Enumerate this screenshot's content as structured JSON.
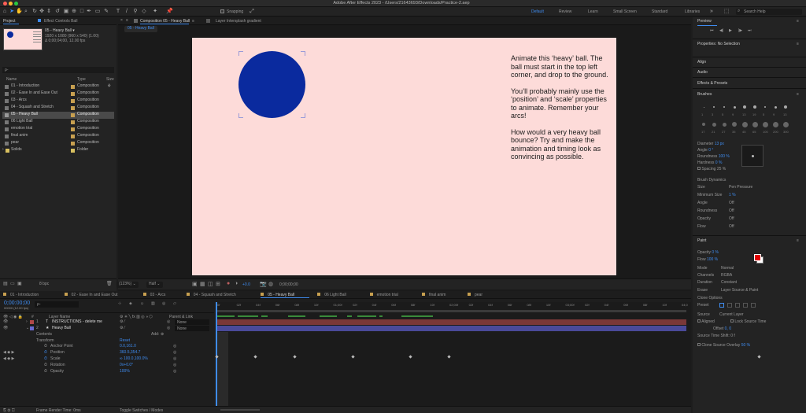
{
  "window_title": "Adobe After Effects 2023 - /Users/21643693/Downloads/Practice-2.aep",
  "toolbar": {
    "snapping": "Snapping",
    "search_placeholder": "Search Help",
    "workspaces": [
      "Default",
      "Review",
      "Learn",
      "Small Screen",
      "Standard",
      "Libraries"
    ]
  },
  "project": {
    "tab": "Project",
    "effect_tab": "Effect Controls Ball",
    "item_name": "05 - Heavy Ball ▾",
    "item_info1": "1920 x 1080 (960 x 540) (1.00)",
    "item_info2": "Δ 0;00;04;00, 12.00 fps",
    "search_placeholder": "ρ-",
    "columns": {
      "name": "Name",
      "type": "Type",
      "size": "Size"
    },
    "items": [
      {
        "name": "01 - Introduction",
        "type": "Composition",
        "color": "#c8a050"
      },
      {
        "name": "02 - Ease In and Ease Out",
        "type": "Composition",
        "color": "#c8a050"
      },
      {
        "name": "03 - Arcs",
        "type": "Composition",
        "color": "#c8a050"
      },
      {
        "name": "04 - Squash and Stretch",
        "type": "Composition",
        "color": "#c8a050"
      },
      {
        "name": "05 - Heavy Ball",
        "type": "Composition",
        "color": "#c8a050"
      },
      {
        "name": "06 Light Ball",
        "type": "Composition",
        "color": "#c8a050"
      },
      {
        "name": "emotion trial",
        "type": "Composition",
        "color": "#c8a050"
      },
      {
        "name": "final anim",
        "type": "Composition",
        "color": "#c8a050"
      },
      {
        "name": "pear",
        "type": "Composition",
        "color": "#c8a050"
      },
      {
        "name": "Solids",
        "type": "Folder",
        "color": "#d8c060"
      }
    ],
    "bpc": "8 bpc"
  },
  "composition": {
    "tab_label": "Composition 05 - Heavy Ball",
    "tab_menu": "≡",
    "layer_tab": "Layer Intersplash gradient",
    "breadcrumb": "05 - Heavy Ball",
    "instructions": [
      "Animate this ‘heavy’ ball. The ball must start in the top left corner, and drop to the ground.",
      "You’ll probably mainly use the ‘position’ and ‘scale’ properties to animate. Remember your arcs!",
      "How would a very heavy ball bounce? Try and make the animation and timing look as convincing as possible."
    ],
    "colors": {
      "canvas": "#fddbd9",
      "ball": "#0a2a9e"
    },
    "footer": {
      "zoom": "(123%)",
      "resolution": "Half",
      "exposure": "+0.0",
      "timecode": "0;00;00;00"
    }
  },
  "timeline": {
    "tabs": [
      "01 - Introduction",
      "02 - Ease In and Ease Out",
      "03 - Arcs",
      "04 - Squash and Stretch",
      "05 - Heavy Ball",
      "06 Light Ball",
      "emotion trial",
      "final anim",
      "pear"
    ],
    "active_tab": "05 - Heavy Ball",
    "timecode": "0;00:00;00",
    "fps": "00000 (12.00 fps)",
    "search_placeholder": "ρ-",
    "columns": {
      "layer_name": "Layer Name",
      "parent": "Parent & Link"
    },
    "layers": [
      {
        "num": "1",
        "name": "INSTRUCTIONS - delete me",
        "parent": "None",
        "color": "#b04848"
      },
      {
        "num": "2",
        "name": "Heavy Ball",
        "parent": "None",
        "color": "#6a6ad0"
      }
    ],
    "contents": "Contents",
    "add": "Add:",
    "transform": "Transform",
    "reset": "Reset",
    "properties": [
      {
        "name": "Anchor Point",
        "value": "0.0,161.0"
      },
      {
        "name": "Position",
        "value": "360.5,354.7"
      },
      {
        "name": "Scale",
        "value": "∞ 100.0,100.0%"
      },
      {
        "name": "Rotation",
        "value": "0x+0.0°"
      },
      {
        "name": "Opacity",
        "value": "100%"
      }
    ],
    "ruler_ticks": [
      "0f",
      "02f",
      "04f",
      "06f",
      "08f",
      "10f",
      "01;00f",
      "02f",
      "04f",
      "06f",
      "08f",
      "10f",
      "02;00f",
      "02f",
      "04f",
      "06f",
      "08f",
      "10f",
      "03;00f",
      "02f",
      "04f",
      "06f",
      "08f",
      "10f",
      "04;0"
    ],
    "position_keyframes_s": [
      0.0,
      0.33,
      0.67,
      1.17,
      1.67,
      2.0,
      4.67
    ],
    "footer": {
      "render_time": "Frame Render Time: 0ms",
      "toggle": "Toggle Switches / Modes"
    }
  },
  "right": {
    "preview": "Preview",
    "properties": "Properties: No Selection",
    "align": "Align",
    "audio": "Audio",
    "effects": "Effects & Presets",
    "brushes": "Brushes",
    "brush_sizes": [
      "1",
      "3",
      "5",
      "9",
      "13",
      "19",
      "5",
      "9",
      "13",
      "17",
      "21",
      "27",
      "35",
      "45",
      "65",
      "100",
      "200",
      "300"
    ],
    "brush_params": [
      {
        "label": "Diameter",
        "value": "13 px"
      },
      {
        "label": "Angle",
        "value": "0 °"
      },
      {
        "label": "Roundness",
        "value": "100 %"
      },
      {
        "label": "Hardness",
        "value": "0 %"
      }
    ],
    "spacing": "Spacing 25 %",
    "dynamics": "Brush Dynamics",
    "dyn_rows": [
      {
        "label": "Size",
        "value": "Pen Pressure"
      },
      {
        "label": "Minimum Size",
        "value": "1 %"
      },
      {
        "label": "Angle",
        "value": "Off"
      },
      {
        "label": "Roundness",
        "value": "Off"
      },
      {
        "label": "Opacity",
        "value": "Off"
      },
      {
        "label": "Flow",
        "value": "Off"
      }
    ],
    "paint": "Paint",
    "paint_rows": [
      {
        "label": "Opacity",
        "value": "0 %"
      },
      {
        "label": "Flow",
        "value": "100 %"
      },
      {
        "label": "Mode",
        "value": "Normal"
      },
      {
        "label": "Channels",
        "value": "RGBA"
      },
      {
        "label": "Duration",
        "value": "Constant"
      },
      {
        "label": "Erase",
        "value": "Layer Source & Paint"
      }
    ],
    "clone_options": "Clone Options",
    "preset": "Preset",
    "source": "Source",
    "source_val": "Current Layer",
    "aligned": "Aligned",
    "lock_source": "Lock Source Time",
    "offset": "Offset",
    "offset_val": "0, 0",
    "source_time": "Source Time Shift: 0 f",
    "clone_overlay": "Clone Source Overlay",
    "overlay_val": "50 %",
    "fg_color": "#e00000"
  }
}
